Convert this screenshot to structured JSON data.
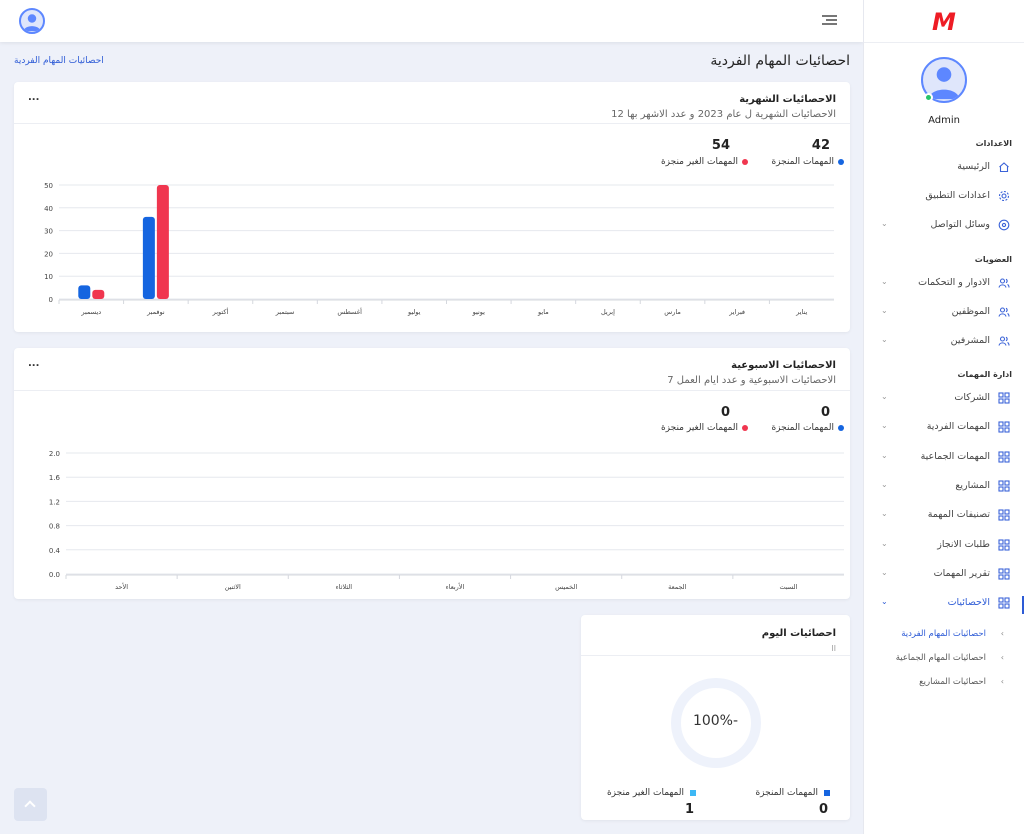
{
  "brand": {
    "logo": "M",
    "color": "#ee1c25"
  },
  "user": {
    "name": "Admin"
  },
  "sidebar": {
    "sections": [
      {
        "title": "الاعدادات",
        "items": [
          {
            "label": "الرئيسية",
            "icon": "home-icon",
            "chevron": false
          },
          {
            "label": "اعدادات التطبيق",
            "icon": "gear-icon",
            "chevron": false
          },
          {
            "label": "وسائل التواصل",
            "icon": "network-icon",
            "chevron": true
          }
        ]
      },
      {
        "title": "العضويات",
        "items": [
          {
            "label": "الادوار و التحكمات",
            "icon": "users-icon",
            "chevron": true
          },
          {
            "label": "الموظفين",
            "icon": "users-icon",
            "chevron": true
          },
          {
            "label": "المشرفين",
            "icon": "users-icon",
            "chevron": true
          }
        ]
      },
      {
        "title": "ادارة المهمات",
        "items": [
          {
            "label": "الشركات",
            "icon": "grid-icon",
            "chevron": true
          },
          {
            "label": "المهمات الفردية",
            "icon": "grid-icon",
            "chevron": true
          },
          {
            "label": "المهمات الجماعية",
            "icon": "grid-icon",
            "chevron": true
          },
          {
            "label": "المشاريع",
            "icon": "grid-icon",
            "chevron": true
          },
          {
            "label": "تصنيفات المهمة",
            "icon": "grid-icon",
            "chevron": true
          },
          {
            "label": "طلبات الانجاز",
            "icon": "grid-icon",
            "chevron": true
          },
          {
            "label": "تقرير المهمات",
            "icon": "grid-icon",
            "chevron": true
          },
          {
            "label": "الاحصائيات",
            "icon": "grid-icon",
            "chevron": true,
            "active": true
          }
        ]
      }
    ],
    "subitems": [
      {
        "label": "احصائيات المهام الفردية",
        "active": true
      },
      {
        "label": "احصائيات المهام الجماعية",
        "active": false
      },
      {
        "label": "احصائيات المشاريع",
        "active": false
      }
    ]
  },
  "page": {
    "title": "احصائيات المهام الفردية",
    "breadcrumb": "احصائيات المهام الفردية"
  },
  "colors": {
    "done": "#1565e0",
    "not_done": "#f0364f",
    "accent": "#2d5bd6"
  },
  "monthly": {
    "title": "الاحصائيات الشهرية",
    "subtitle": "الاحصائيات الشهرية ل عام 2023 و عدد الاشهر بها 12",
    "more": "...",
    "done_count": "42",
    "done_label": "المهمات المنجزة",
    "not_done_count": "54",
    "not_done_label": "المهمات الغير منجزة"
  },
  "weekly": {
    "title": "الاحصائيات الاسبوعية",
    "subtitle": "الاحصائيات الاسبوعية و عدد ايام العمل 7",
    "more": "...",
    "done_count": "0",
    "done_label": "المهمات المنجزة",
    "not_done_count": "0",
    "not_done_label": "المهمات الغير منجزة"
  },
  "today": {
    "title": "احصائيات اليوم",
    "sub": "ll",
    "percent": "100%-",
    "done_label": "المهمات المنجزة",
    "done_value": "0",
    "not_done_label": "المهمات الغير منجزة",
    "not_done_value": "1",
    "done_color": "#1565e0",
    "not_done_color": "#3db8f5"
  },
  "chart_data": [
    {
      "type": "bar",
      "categories": [
        "يناير",
        "فبراير",
        "مارس",
        "إبريل",
        "مايو",
        "يونيو",
        "يوليو",
        "أغسطس",
        "سبتمبر",
        "أكتوبر",
        "نوفمبر",
        "ديسمبر"
      ],
      "series": [
        {
          "name": "المهمات المنجزة",
          "color": "#1565e0",
          "values": [
            0,
            0,
            0,
            0,
            0,
            0,
            0,
            0,
            0,
            0,
            36,
            6
          ]
        },
        {
          "name": "المهمات الغير منجزة",
          "color": "#f0364f",
          "values": [
            0,
            0,
            0,
            0,
            0,
            0,
            0,
            0,
            0,
            0,
            50,
            4
          ]
        }
      ],
      "yticks": [
        0,
        10,
        20,
        30,
        40,
        50
      ],
      "ylim": [
        0,
        50
      ],
      "x_direction": "right-to-left",
      "grid": true
    },
    {
      "type": "bar",
      "categories": [
        "السبت",
        "الجمعة",
        "الخميس",
        "الأربعاء",
        "الثلاثاء",
        "الاثنين",
        "الأحد"
      ],
      "series": [
        {
          "name": "المهمات المنجزة",
          "color": "#1565e0",
          "values": [
            0,
            0,
            0,
            0,
            0,
            0,
            0
          ]
        },
        {
          "name": "المهمات الغير منجزة",
          "color": "#f0364f",
          "values": [
            0,
            0,
            0,
            0,
            0,
            0,
            0
          ]
        }
      ],
      "yticks": [
        "0.0",
        "0.4",
        "0.8",
        "1.2",
        "1.6",
        "2.0"
      ],
      "ylim": [
        0,
        2
      ],
      "x_direction": "right-to-left",
      "grid": true
    }
  ]
}
